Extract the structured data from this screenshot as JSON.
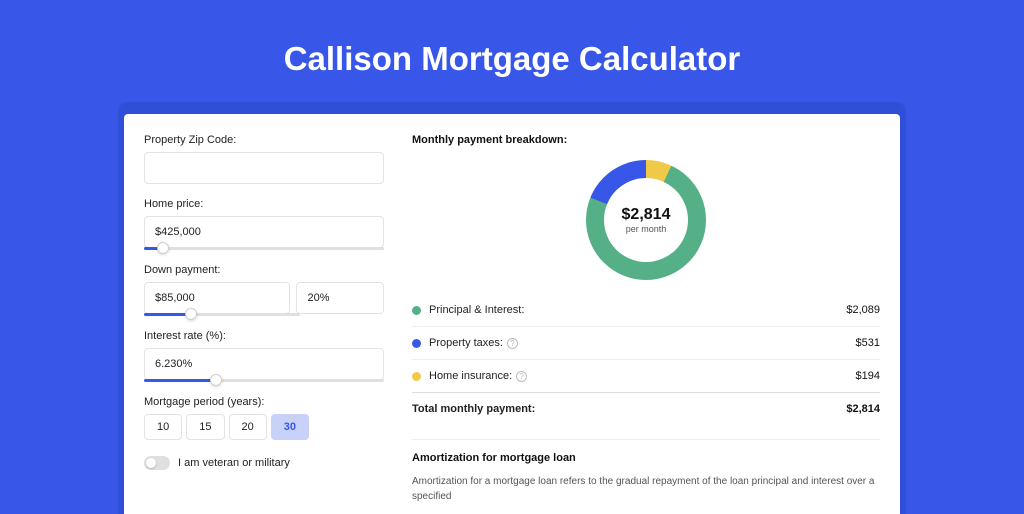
{
  "title": "Callison Mortgage Calculator",
  "form": {
    "zip": {
      "label": "Property Zip Code:",
      "value": ""
    },
    "price": {
      "label": "Home price:",
      "value": "$425,000",
      "slider_pct": 8
    },
    "down": {
      "label": "Down payment:",
      "amount": "$85,000",
      "pct": "20%",
      "slider_pct": 20
    },
    "rate": {
      "label": "Interest rate (%):",
      "value": "6.230%",
      "slider_pct": 30
    },
    "period": {
      "label": "Mortgage period (years):",
      "options": [
        "10",
        "15",
        "20",
        "30"
      ],
      "selected": "30"
    },
    "veteran": {
      "label": "I am veteran or military",
      "on": false
    }
  },
  "breakdown": {
    "heading": "Monthly payment breakdown:",
    "center_amount": "$2,814",
    "center_sub": "per month",
    "rows": [
      {
        "label": "Principal & Interest:",
        "value": "$2,089",
        "color": "#55b087",
        "help": false
      },
      {
        "label": "Property taxes:",
        "value": "$531",
        "color": "#3857e8",
        "help": true
      },
      {
        "label": "Home insurance:",
        "value": "$194",
        "color": "#f0c94a",
        "help": true
      }
    ],
    "total": {
      "label": "Total monthly payment:",
      "value": "$2,814"
    }
  },
  "chart_data": {
    "type": "pie",
    "title": "Monthly payment breakdown",
    "series": [
      {
        "name": "Principal & Interest",
        "value": 2089,
        "color": "#55b087"
      },
      {
        "name": "Property taxes",
        "value": 531,
        "color": "#3857e8"
      },
      {
        "name": "Home insurance",
        "value": 194,
        "color": "#f0c94a"
      }
    ],
    "total": 2814,
    "unit": "USD per month"
  },
  "amort": {
    "title": "Amortization for mortgage loan",
    "text": "Amortization for a mortgage loan refers to the gradual repayment of the loan principal and interest over a specified"
  }
}
